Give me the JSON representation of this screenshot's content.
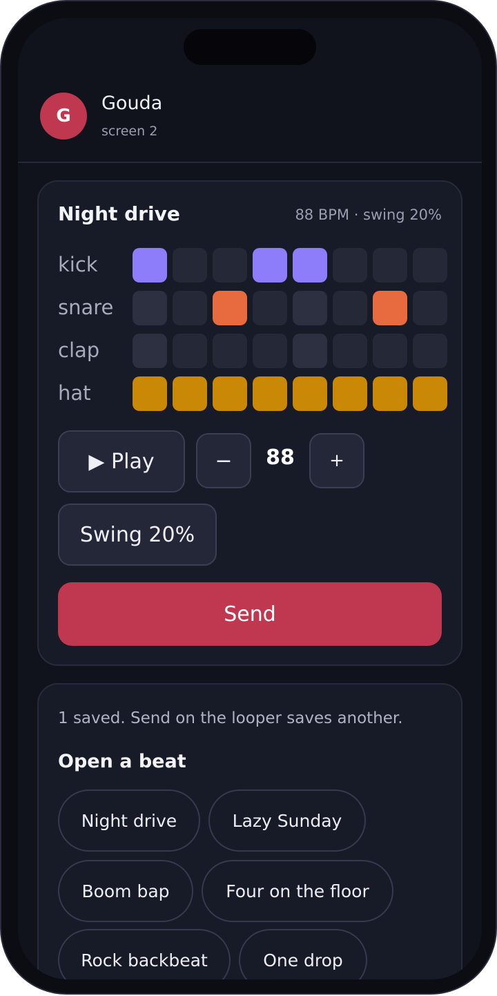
{
  "contact": {
    "initial": "G",
    "name": "Gouda",
    "subtitle": "screen 2"
  },
  "looper": {
    "title": "Night drive",
    "meta": "88 BPM · swing 20%",
    "tracks": [
      {
        "label": "kick",
        "steps": [
          1,
          0,
          0,
          1,
          1,
          0,
          0,
          0
        ]
      },
      {
        "label": "snare",
        "steps": [
          0,
          0,
          1,
          0,
          0,
          0,
          1,
          0
        ]
      },
      {
        "label": "clap",
        "steps": [
          0,
          0,
          0,
          0,
          0,
          0,
          0,
          0
        ]
      },
      {
        "label": "hat",
        "steps": [
          1,
          1,
          1,
          1,
          1,
          1,
          1,
          1
        ]
      }
    ],
    "play_label": "▶ Play",
    "minus_label": "−",
    "bpm": "88",
    "plus_label": "+",
    "swing_label": "Swing 20%",
    "send_label": "Send"
  },
  "library": {
    "note": "1 saved. Send on the looper saves another.",
    "heading": "Open a beat",
    "beats": [
      "Night drive",
      "Lazy Sunday",
      "Boom bap",
      "Four on the floor",
      "Rock backbeat",
      "One drop"
    ]
  },
  "colors": {
    "accent": "#c0384f",
    "kick": "#8d7dfb",
    "snare": "#e86b3f",
    "hat": "#c98805"
  }
}
